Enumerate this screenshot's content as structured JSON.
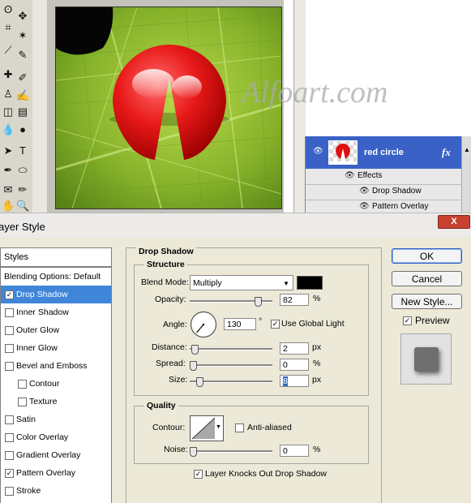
{
  "watermark": "Alfoart.com",
  "layers": {
    "layer_name": "red circle",
    "fx_label": "fx",
    "effects_label": "Effects",
    "effects": [
      "Drop Shadow",
      "Pattern Overlay"
    ]
  },
  "dialog": {
    "title": "ayer Style",
    "close_label": "X",
    "styles_header": "Styles",
    "style_items": [
      {
        "label": "Blending Options: Default",
        "checkbox": false,
        "checked": false,
        "selected": false,
        "indent": false
      },
      {
        "label": "Drop Shadow",
        "checkbox": true,
        "checked": true,
        "selected": true,
        "indent": false
      },
      {
        "label": "Inner Shadow",
        "checkbox": true,
        "checked": false,
        "selected": false,
        "indent": false
      },
      {
        "label": "Outer Glow",
        "checkbox": true,
        "checked": false,
        "selected": false,
        "indent": false
      },
      {
        "label": "Inner Glow",
        "checkbox": true,
        "checked": false,
        "selected": false,
        "indent": false
      },
      {
        "label": "Bevel and Emboss",
        "checkbox": true,
        "checked": false,
        "selected": false,
        "indent": false
      },
      {
        "label": "Contour",
        "checkbox": true,
        "checked": false,
        "selected": false,
        "indent": true
      },
      {
        "label": "Texture",
        "checkbox": true,
        "checked": false,
        "selected": false,
        "indent": true
      },
      {
        "label": "Satin",
        "checkbox": true,
        "checked": false,
        "selected": false,
        "indent": false
      },
      {
        "label": "Color Overlay",
        "checkbox": true,
        "checked": false,
        "selected": false,
        "indent": false
      },
      {
        "label": "Gradient Overlay",
        "checkbox": true,
        "checked": false,
        "selected": false,
        "indent": false
      },
      {
        "label": "Pattern Overlay",
        "checkbox": true,
        "checked": true,
        "selected": false,
        "indent": false
      },
      {
        "label": "Stroke",
        "checkbox": true,
        "checked": false,
        "selected": false,
        "indent": false
      }
    ],
    "section_title": "Drop Shadow",
    "structure_title": "Structure",
    "blend_mode_label": "Blend Mode:",
    "blend_mode_value": "Multiply",
    "shadow_color": "#000000",
    "opacity_label": "Opacity:",
    "opacity_value": "82",
    "opacity_fraction": 0.82,
    "percent": "%",
    "angle_label": "Angle:",
    "angle_value": "130",
    "angle_degrees": 130,
    "degree_symbol": "°",
    "global_light_label": "Use Global Light",
    "distance_label": "Distance:",
    "distance_value": "2",
    "spread_label": "Spread:",
    "spread_value": "0",
    "size_label": "Size:",
    "size_value": "8",
    "px": "px",
    "quality_title": "Quality",
    "contour_label": "Contour:",
    "anti_aliased_label": "Anti-aliased",
    "noise_label": "Noise:",
    "noise_value": "0",
    "knocks_out_label": "Layer Knocks Out Drop Shadow",
    "ok_label": "OK",
    "cancel_label": "Cancel",
    "new_style_label": "New Style...",
    "preview_label": "Preview",
    "accent_color": "#3f86d9"
  }
}
